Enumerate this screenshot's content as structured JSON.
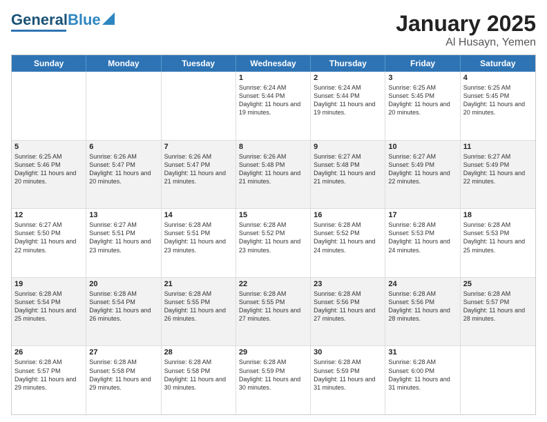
{
  "header": {
    "logo_main": "General",
    "logo_sub": "Blue",
    "month": "January 2025",
    "location": "Al Husayn, Yemen"
  },
  "days_of_week": [
    "Sunday",
    "Monday",
    "Tuesday",
    "Wednesday",
    "Thursday",
    "Friday",
    "Saturday"
  ],
  "weeks": [
    [
      {
        "day": "",
        "info": ""
      },
      {
        "day": "",
        "info": ""
      },
      {
        "day": "",
        "info": ""
      },
      {
        "day": "1",
        "info": "Sunrise: 6:24 AM\nSunset: 5:44 PM\nDaylight: 11 hours and 19 minutes."
      },
      {
        "day": "2",
        "info": "Sunrise: 6:24 AM\nSunset: 5:44 PM\nDaylight: 11 hours and 19 minutes."
      },
      {
        "day": "3",
        "info": "Sunrise: 6:25 AM\nSunset: 5:45 PM\nDaylight: 11 hours and 20 minutes."
      },
      {
        "day": "4",
        "info": "Sunrise: 6:25 AM\nSunset: 5:45 PM\nDaylight: 11 hours and 20 minutes."
      }
    ],
    [
      {
        "day": "5",
        "info": "Sunrise: 6:25 AM\nSunset: 5:46 PM\nDaylight: 11 hours and 20 minutes."
      },
      {
        "day": "6",
        "info": "Sunrise: 6:26 AM\nSunset: 5:47 PM\nDaylight: 11 hours and 20 minutes."
      },
      {
        "day": "7",
        "info": "Sunrise: 6:26 AM\nSunset: 5:47 PM\nDaylight: 11 hours and 21 minutes."
      },
      {
        "day": "8",
        "info": "Sunrise: 6:26 AM\nSunset: 5:48 PM\nDaylight: 11 hours and 21 minutes."
      },
      {
        "day": "9",
        "info": "Sunrise: 6:27 AM\nSunset: 5:48 PM\nDaylight: 11 hours and 21 minutes."
      },
      {
        "day": "10",
        "info": "Sunrise: 6:27 AM\nSunset: 5:49 PM\nDaylight: 11 hours and 22 minutes."
      },
      {
        "day": "11",
        "info": "Sunrise: 6:27 AM\nSunset: 5:49 PM\nDaylight: 11 hours and 22 minutes."
      }
    ],
    [
      {
        "day": "12",
        "info": "Sunrise: 6:27 AM\nSunset: 5:50 PM\nDaylight: 11 hours and 22 minutes."
      },
      {
        "day": "13",
        "info": "Sunrise: 6:27 AM\nSunset: 5:51 PM\nDaylight: 11 hours and 23 minutes."
      },
      {
        "day": "14",
        "info": "Sunrise: 6:28 AM\nSunset: 5:51 PM\nDaylight: 11 hours and 23 minutes."
      },
      {
        "day": "15",
        "info": "Sunrise: 6:28 AM\nSunset: 5:52 PM\nDaylight: 11 hours and 23 minutes."
      },
      {
        "day": "16",
        "info": "Sunrise: 6:28 AM\nSunset: 5:52 PM\nDaylight: 11 hours and 24 minutes."
      },
      {
        "day": "17",
        "info": "Sunrise: 6:28 AM\nSunset: 5:53 PM\nDaylight: 11 hours and 24 minutes."
      },
      {
        "day": "18",
        "info": "Sunrise: 6:28 AM\nSunset: 5:53 PM\nDaylight: 11 hours and 25 minutes."
      }
    ],
    [
      {
        "day": "19",
        "info": "Sunrise: 6:28 AM\nSunset: 5:54 PM\nDaylight: 11 hours and 25 minutes."
      },
      {
        "day": "20",
        "info": "Sunrise: 6:28 AM\nSunset: 5:54 PM\nDaylight: 11 hours and 26 minutes."
      },
      {
        "day": "21",
        "info": "Sunrise: 6:28 AM\nSunset: 5:55 PM\nDaylight: 11 hours and 26 minutes."
      },
      {
        "day": "22",
        "info": "Sunrise: 6:28 AM\nSunset: 5:55 PM\nDaylight: 11 hours and 27 minutes."
      },
      {
        "day": "23",
        "info": "Sunrise: 6:28 AM\nSunset: 5:56 PM\nDaylight: 11 hours and 27 minutes."
      },
      {
        "day": "24",
        "info": "Sunrise: 6:28 AM\nSunset: 5:56 PM\nDaylight: 11 hours and 28 minutes."
      },
      {
        "day": "25",
        "info": "Sunrise: 6:28 AM\nSunset: 5:57 PM\nDaylight: 11 hours and 28 minutes."
      }
    ],
    [
      {
        "day": "26",
        "info": "Sunrise: 6:28 AM\nSunset: 5:57 PM\nDaylight: 11 hours and 29 minutes."
      },
      {
        "day": "27",
        "info": "Sunrise: 6:28 AM\nSunset: 5:58 PM\nDaylight: 11 hours and 29 minutes."
      },
      {
        "day": "28",
        "info": "Sunrise: 6:28 AM\nSunset: 5:58 PM\nDaylight: 11 hours and 30 minutes."
      },
      {
        "day": "29",
        "info": "Sunrise: 6:28 AM\nSunset: 5:59 PM\nDaylight: 11 hours and 30 minutes."
      },
      {
        "day": "30",
        "info": "Sunrise: 6:28 AM\nSunset: 5:59 PM\nDaylight: 11 hours and 31 minutes."
      },
      {
        "day": "31",
        "info": "Sunrise: 6:28 AM\nSunset: 6:00 PM\nDaylight: 11 hours and 31 minutes."
      },
      {
        "day": "",
        "info": ""
      }
    ]
  ]
}
